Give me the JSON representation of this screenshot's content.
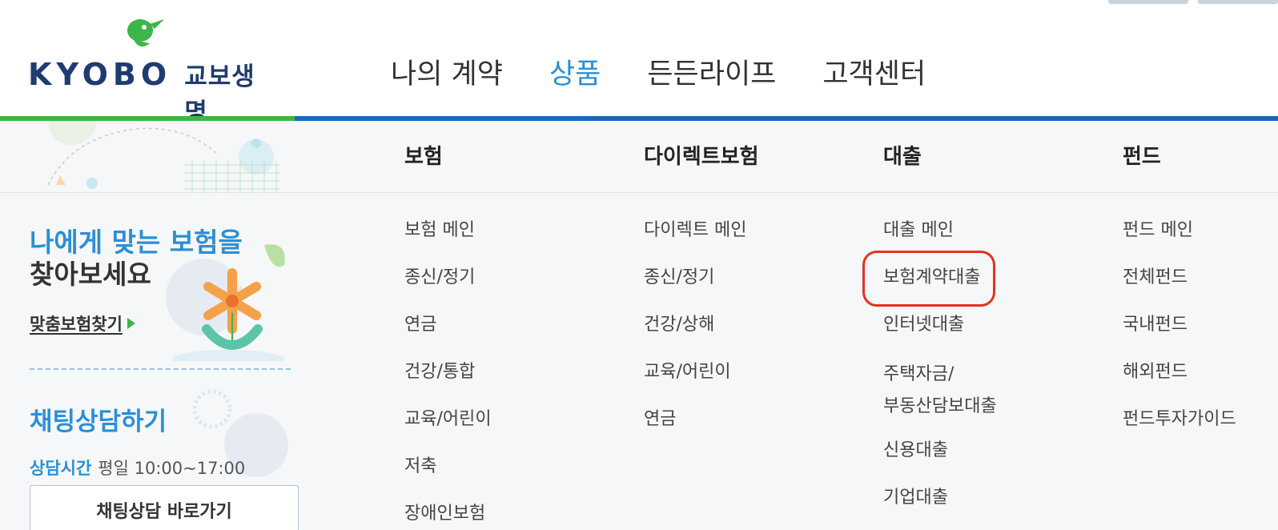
{
  "logo": {
    "en": "KYOBO",
    "ko": "교보생명"
  },
  "gnb": [
    "나의 계약",
    "상품",
    "든든라이프",
    "고객센터"
  ],
  "left": {
    "rec_title_line1": "나에게 맞는 보험을",
    "rec_title_line2": "찾아보세요",
    "rec_link": "맞춤보험찾기",
    "chat_title": "채팅상담하기",
    "chat_hours_label": "상담시간",
    "chat_hours_value": "평일 10:00~17:00",
    "chat_button": "채팅상담 바로가기"
  },
  "menu": {
    "insurance": {
      "title": "보험",
      "items": [
        "보험 메인",
        "종신/정기",
        "연금",
        "건강/통합",
        "교육/어린이",
        "저축",
        "장애인보험"
      ]
    },
    "direct": {
      "title": "다이렉트보험",
      "items": [
        "다이렉트 메인",
        "종신/정기",
        "건강/상해",
        "교육/어린이",
        "연금"
      ]
    },
    "loan": {
      "title": "대출",
      "items": [
        "대출 메인",
        "보험계약대출",
        "인터넷대출",
        "주택자금/",
        "부동산담보대출",
        "신용대출",
        "기업대출"
      ]
    },
    "fund": {
      "title": "펀드",
      "items": [
        "펀드 메인",
        "전체펀드",
        "국내펀드",
        "해외펀드",
        "펀드투자가이드"
      ]
    }
  },
  "colors": {
    "accent_blue": "#2b8fd6",
    "brand_navy": "#1f3b6f",
    "brand_green": "#3cb54a",
    "highlight_red": "#e6311e"
  }
}
